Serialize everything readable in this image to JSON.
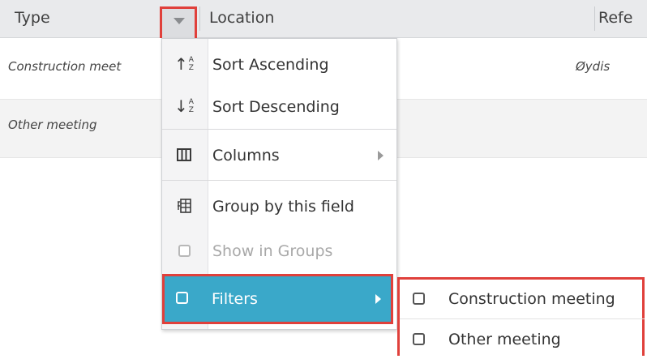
{
  "header": {
    "columns": [
      "Type",
      "Location",
      "Refe"
    ]
  },
  "rows": [
    {
      "type": "Construction meet",
      "location": "Øydis"
    },
    {
      "type": "Other meeting",
      "location": ""
    }
  ],
  "menu": {
    "sort_asc": "Sort Ascending",
    "sort_desc": "Sort Descending",
    "columns": "Columns",
    "group_by": "Group by this field",
    "show_in_groups": "Show in Groups",
    "filters": "Filters"
  },
  "submenu": {
    "items": [
      "Construction meeting",
      "Other meeting"
    ]
  },
  "colors": {
    "highlight": "#3aa8c9",
    "annotation": "#e0403b",
    "header_bg": "#e9eaec"
  }
}
